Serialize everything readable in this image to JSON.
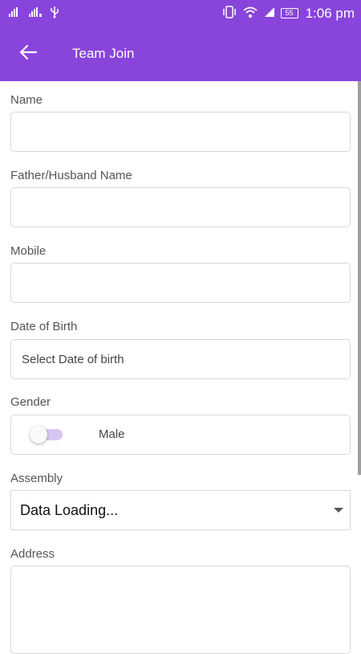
{
  "status_bar": {
    "time": "1:06 pm",
    "battery": "55",
    "left_icons": [
      "signal-icon",
      "signal-icon",
      "usb-icon"
    ],
    "right_icons": [
      "vibrate-icon",
      "wifi-icon",
      "signal-icon",
      "battery-icon"
    ]
  },
  "appbar": {
    "title": "Team Join",
    "back_icon": "arrow-back-icon",
    "background": "#8944dc"
  },
  "form": {
    "name_label": "Name",
    "name_value": "",
    "father_label": "Father/Husband Name",
    "father_value": "",
    "mobile_label": "Mobile",
    "mobile_value": "",
    "dob_label": "Date of Birth",
    "dob_placeholder": "Select Date of birth",
    "gender_label": "Gender",
    "gender_value": "Male",
    "gender_toggle_on": false,
    "assembly_label": "Assembly",
    "assembly_value": "Data Loading...",
    "address_label": "Address",
    "address_value": ""
  }
}
